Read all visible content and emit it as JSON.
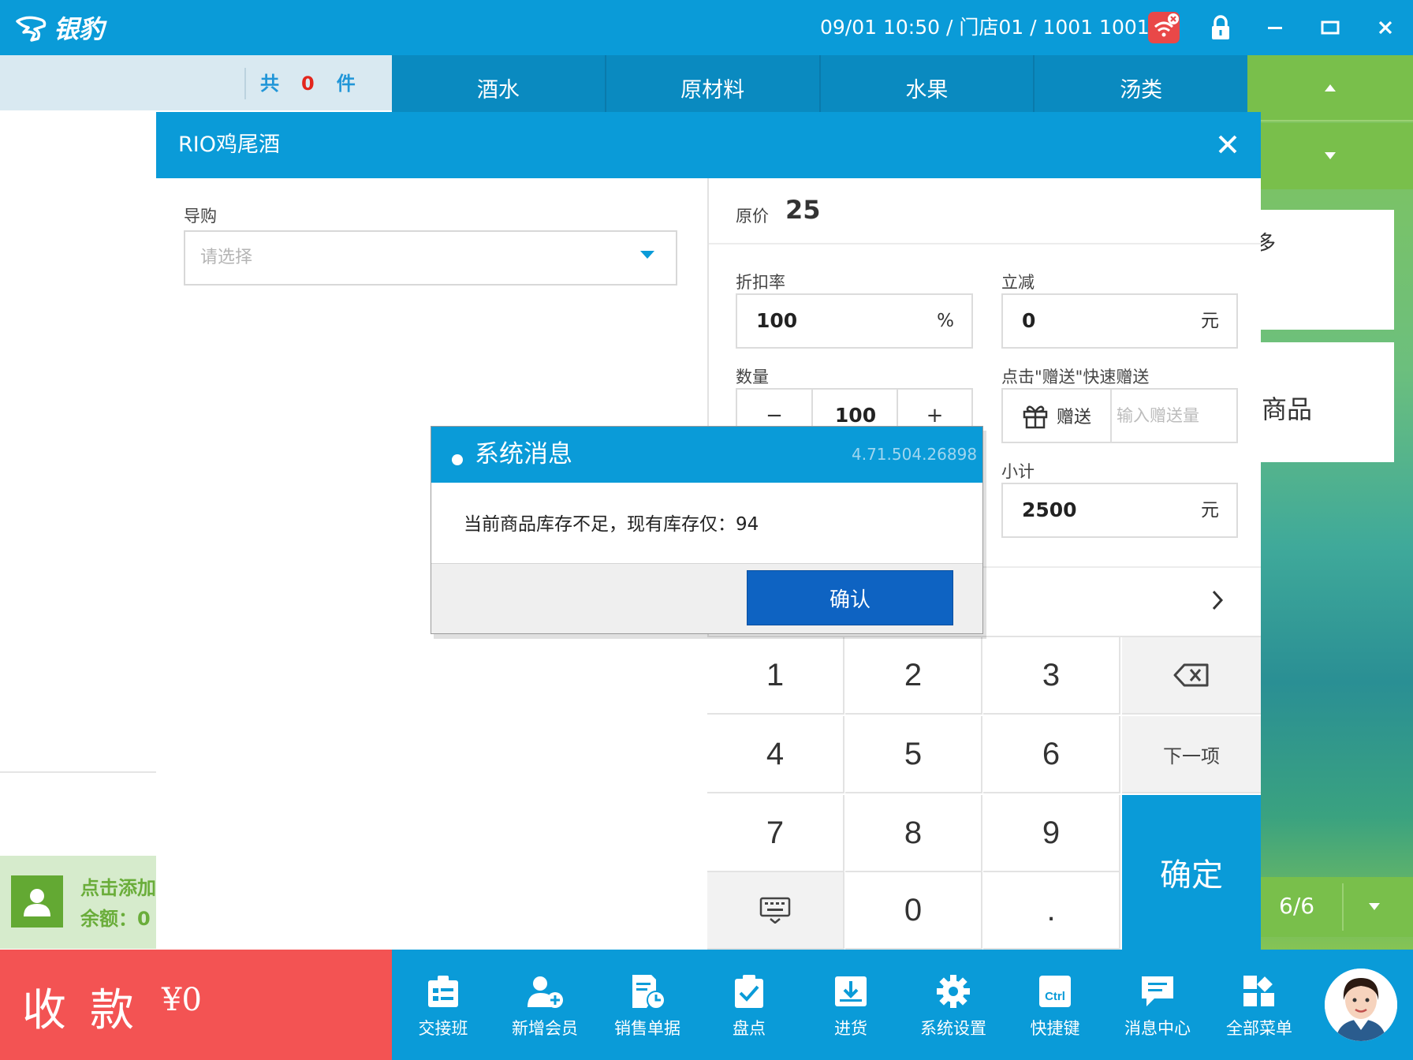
{
  "app": {
    "logo_text": "银豹",
    "status_line": "09/01 10:50 / 门店01 / 1001 1001"
  },
  "cart": {
    "prefix": "共",
    "count": "0",
    "suffix": "件"
  },
  "categories": [
    "酒水",
    "原材料",
    "水果",
    "汤类"
  ],
  "right_panel": {
    "card_text": "商品",
    "card_partial": "多",
    "pager": "6/6"
  },
  "member": {
    "line1": "点击添加会员",
    "line2": "余额：0"
  },
  "pay": {
    "label": "收款",
    "amount": "¥0"
  },
  "toolbar": [
    {
      "label": "交接班",
      "icon": "shift-icon"
    },
    {
      "label": "新增会员",
      "icon": "add-member-icon"
    },
    {
      "label": "销售单据",
      "icon": "sales-doc-icon"
    },
    {
      "label": "盘点",
      "icon": "inventory-check-icon"
    },
    {
      "label": "进货",
      "icon": "purchase-icon"
    },
    {
      "label": "系统设置",
      "icon": "gear-icon"
    },
    {
      "label": "快捷键",
      "icon": "ctrl-key-icon"
    },
    {
      "label": "消息中心",
      "icon": "message-icon"
    },
    {
      "label": "全部菜单",
      "icon": "all-menu-icon"
    }
  ],
  "product_dialog": {
    "title": "RIO鸡尾酒",
    "guide_label": "导购",
    "guide_placeholder": "请选择",
    "price_label": "原价",
    "price_value": "25",
    "discount_label": "折扣率",
    "discount_value": "100",
    "discount_unit": "%",
    "reduce_label": "立减",
    "reduce_value": "0",
    "reduce_unit": "元",
    "qty_label": "数量",
    "qty_minus": "−",
    "qty_value": "100",
    "qty_plus": "+",
    "gift_label": "点击\"赠送\"快速赠送",
    "gift_button": "赠送",
    "gift_placeholder": "输入赠送量",
    "subtotal_label": "小计",
    "subtotal_value": "2500",
    "subtotal_unit": "元",
    "keys": [
      "1",
      "2",
      "3",
      "4",
      "5",
      "6",
      "7",
      "8",
      "9",
      "0",
      "."
    ],
    "key_next": "下一项",
    "key_confirm": "确定"
  },
  "system_message": {
    "title": "系统消息",
    "version": "4.71.504.26898",
    "message": "当前商品库存不足，现有库存仅：94",
    "ok_button": "确认"
  },
  "colors": {
    "primary": "#0a9bd8",
    "pay_red": "#f35353",
    "green": "#79bf4b",
    "confirm_blue": "#0e63c2"
  }
}
